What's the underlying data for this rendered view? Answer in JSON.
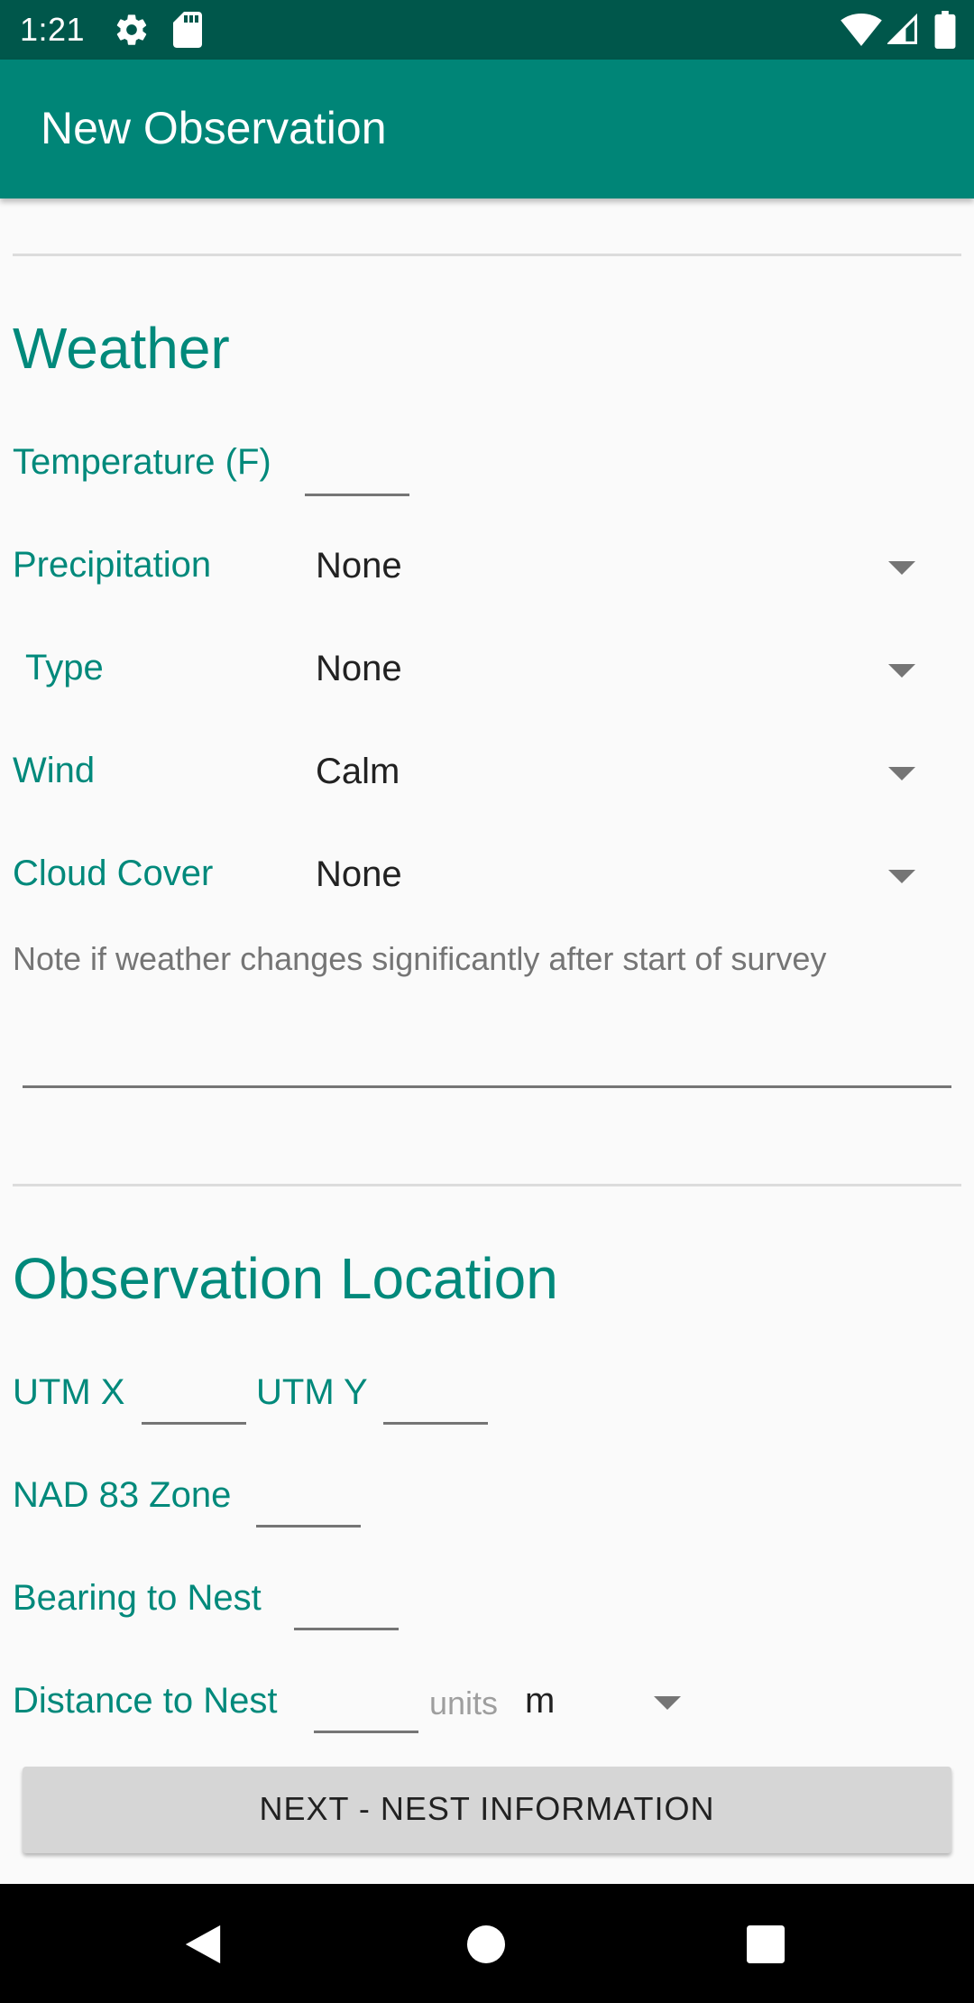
{
  "status_bar": {
    "time": "1:21",
    "icons": [
      "gear-icon",
      "sd-card-icon",
      "wifi-icon",
      "signal-icon",
      "battery-icon"
    ]
  },
  "app_bar": {
    "title": "New Observation",
    "color": "#008577"
  },
  "weather": {
    "heading": "Weather",
    "temperature_label": "Temperature (F)",
    "temperature_value": "",
    "precipitation": {
      "label": "Precipitation",
      "value": "None"
    },
    "type": {
      "label": "Type",
      "value": "None"
    },
    "wind": {
      "label": "Wind",
      "value": "Calm"
    },
    "cloud_cover": {
      "label": "Cloud Cover",
      "value": "None"
    },
    "note": "Note if weather changes significantly after start of survey",
    "note_value": ""
  },
  "location": {
    "heading": "Observation Location",
    "utm_x_label": "UTM X",
    "utm_x_value": "",
    "utm_y_label": "UTM Y",
    "utm_y_value": "",
    "nad83_label": "NAD 83 Zone",
    "nad83_value": "",
    "bearing_label": "Bearing to Nest",
    "bearing_value": "",
    "distance_label": "Distance to Nest",
    "distance_value": "",
    "units_label": "units",
    "units_value": "m"
  },
  "next_button": {
    "label": "NEXT - NEST INFORMATION"
  },
  "colors": {
    "accent": "#00897b",
    "status_bar": "#00574b",
    "background": "#fafafa"
  }
}
